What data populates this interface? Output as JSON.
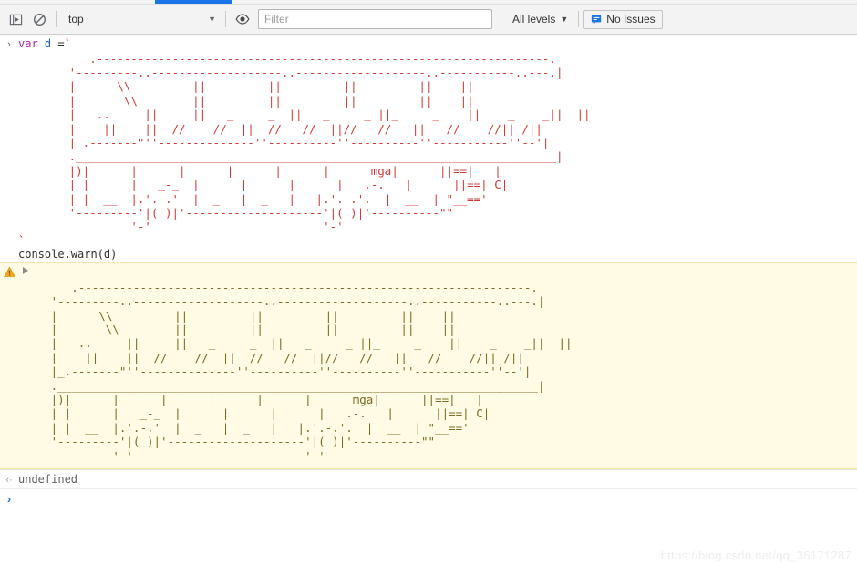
{
  "toolbar": {
    "inspect_icon": "inspect-element-icon",
    "clear_icon": "clear-console-icon",
    "context_value": "top",
    "context_caret": "▼",
    "eye_icon": "live-expression-eye-icon",
    "filter_placeholder": "Filter",
    "filter_value": "",
    "levels_label": "All levels",
    "levels_caret": "▼",
    "issues_icon": "issues-message-icon",
    "issues_label": "No Issues"
  },
  "console": {
    "input_prompt": "›",
    "output_prompt": "‹·",
    "bottom_prompt": "›",
    "line1_keyword": "var",
    "line1_name": "d",
    "line1_operator": " =",
    "line1_backtick": "`",
    "closing_backtick": "`",
    "line2_code": "console.warn(d)",
    "result_value": "undefined",
    "warning_icon": "warning-triangle-icon",
    "disclosure_icon": "disclosure-triangle-right-icon"
  },
  "ascii_art": {
    "title": "bus-ascii-art",
    "red_color": "#cf3b3b",
    "olive_color": "#7a6a22",
    "lines": [
      "        .------------------------------------------------------------------.",
      "     '---------..-------------------..-------------------..-----------..---.|",
      "     |      \\\\         ||         ||         ||         ||    ||",
      "     |       \\\\        ||         ||         ||         ||    ||",
      "     |   ..     ||     ||   _     _  ||   _     _ ||_     _    ||    _    _||  ||",
      "     |    ||    ||  //    //  ||  //   //  ||//   //   ||   //    //|| /||",
      "     |_.-------\"''--------------''----------''----------''-----------''--'|",
      "     .______________________________________________________________________|",
      "     |)|      |      |      |      |      |      mga|      ||==|   |",
      "     | |      |   _-_  |      |      |      |   .-.   |      ||==| C|",
      "     | |  __  |.'.-.'  |  _   |  _   |   |.'.-.'.  |  __  | \"__==' ",
      "     '---------'|( )|'--------------------'|( )|'----------\"\"",
      "              '-'                         '-'"
    ]
  },
  "watermark": "https://blog.csdn.net/qq_36171287"
}
